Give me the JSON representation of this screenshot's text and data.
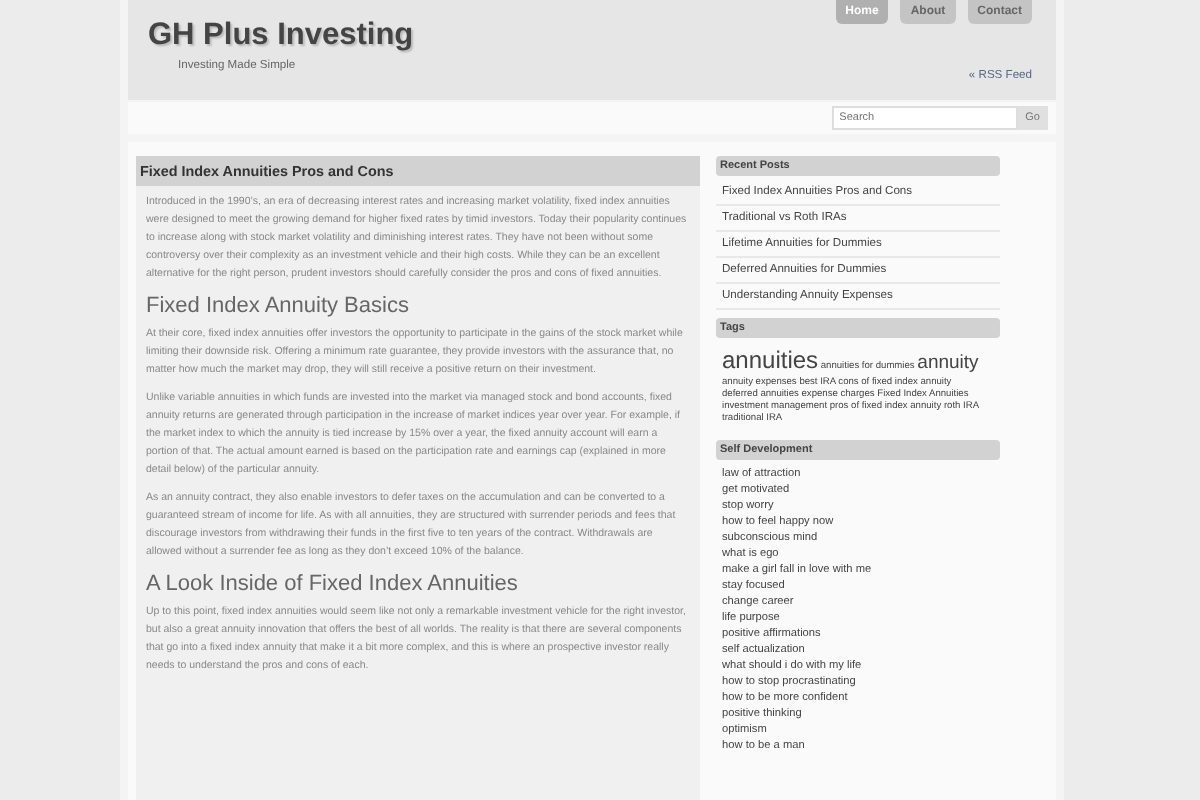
{
  "header": {
    "title": "GH Plus Investing",
    "tagline": "Investing Made Simple",
    "rss": "« RSS Feed"
  },
  "nav": [
    {
      "label": "Home",
      "selected": true
    },
    {
      "label": "About",
      "selected": false
    },
    {
      "label": "Contact",
      "selected": false
    }
  ],
  "search": {
    "placeholder": "Search",
    "button": "Go"
  },
  "post": {
    "title": "Fixed Index Annuities Pros and Cons",
    "blocks": [
      {
        "kind": "p",
        "text": "Introduced in the 1990’s, an era of decreasing interest rates and increasing market volatility, fixed index annuities were designed to meet the growing demand for higher fixed rates by timid investors. Today their popularity continues to increase along with stock market volatility and diminishing interest rates. They have not been without some controversy over their complexity as an investment vehicle and their high costs. While they can be an excellent alternative for the right person, prudent investors should carefully consider the pros and cons of fixed annuities."
      },
      {
        "kind": "h",
        "text": "Fixed Index Annuity Basics"
      },
      {
        "kind": "p",
        "text": "At their core, fixed index annuities offer investors the opportunity to participate in the gains of the stock market while limiting their downside risk. Offering a minimum rate guarantee, they provide investors with the assurance that, no matter how much the market may drop, they will still receive a positive return on their investment."
      },
      {
        "kind": "p",
        "text": "Unlike variable annuities in which funds are invested into the market via managed stock and bond accounts, fixed annuity returns are generated through participation in the increase of market indices year over year. For example, if the market index to which the annuity is tied increase by 15% over a year, the fixed annuity account will earn a portion of that. The actual amount earned is based on the participation rate and earnings cap (explained in more detail below) of the particular annuity."
      },
      {
        "kind": "p",
        "text": "As an annuity contract, they also enable investors to defer taxes on the accumulation and can be converted to a guaranteed stream of income for life. As with all annuities, they are structured with surrender periods and fees that discourage investors from withdrawing their funds in the first five to ten years of the contract. Withdrawals are allowed without a surrender fee as long as they don’t exceed 10% of the balance."
      },
      {
        "kind": "h",
        "text": "A Look Inside of Fixed Index Annuities"
      },
      {
        "kind": "p",
        "text": "Up to this point, fixed index annuities would seem like not only a remarkable investment vehicle for the right investor, but also a great annuity innovation that offers the best of all worlds. The reality is that there are several components that go into a fixed index annuity that make it a bit more complex, and this is where an prospective investor really needs to understand the pros and cons of each."
      }
    ]
  },
  "recent_posts": {
    "title": "Recent Posts",
    "items": [
      "Fixed Index Annuities Pros and Cons",
      "Traditional vs Roth IRAs",
      "Lifetime Annuities for Dummies",
      "Deferred Annuities for Dummies",
      "Understanding Annuity Expenses"
    ]
  },
  "tags": {
    "title": "Tags",
    "items": [
      {
        "label": "annuities",
        "kind": "large"
      },
      {
        "label": "annuities for dummies",
        "kind": "small"
      },
      {
        "label": "annuity",
        "kind": "medium"
      },
      {
        "label": "annuity expenses",
        "kind": "small"
      },
      {
        "label": "best IRA",
        "kind": "small"
      },
      {
        "label": "cons of fixed index annuity",
        "kind": "small"
      },
      {
        "label": "deferred annuities",
        "kind": "small"
      },
      {
        "label": "expense charges",
        "kind": "small"
      },
      {
        "label": "Fixed Index Annuities",
        "kind": "small"
      },
      {
        "label": "investment management",
        "kind": "small"
      },
      {
        "label": "pros of fixed index annuity",
        "kind": "small"
      },
      {
        "label": "roth IRA",
        "kind": "small"
      },
      {
        "label": "traditional IRA",
        "kind": "small"
      }
    ]
  },
  "self_development": {
    "title": "Self Development",
    "items": [
      "law of attraction",
      "get motivated",
      "stop worry",
      "how to feel happy now",
      "subconscious mind",
      "what is ego",
      "make a girl fall in love with me",
      "stay focused",
      "change career",
      "life purpose",
      "positive affirmations",
      "self actualization",
      "what should i do with my life",
      "how to stop procrastinating",
      "how to be more confident",
      "positive thinking",
      "optimism",
      "how to be a man"
    ]
  }
}
